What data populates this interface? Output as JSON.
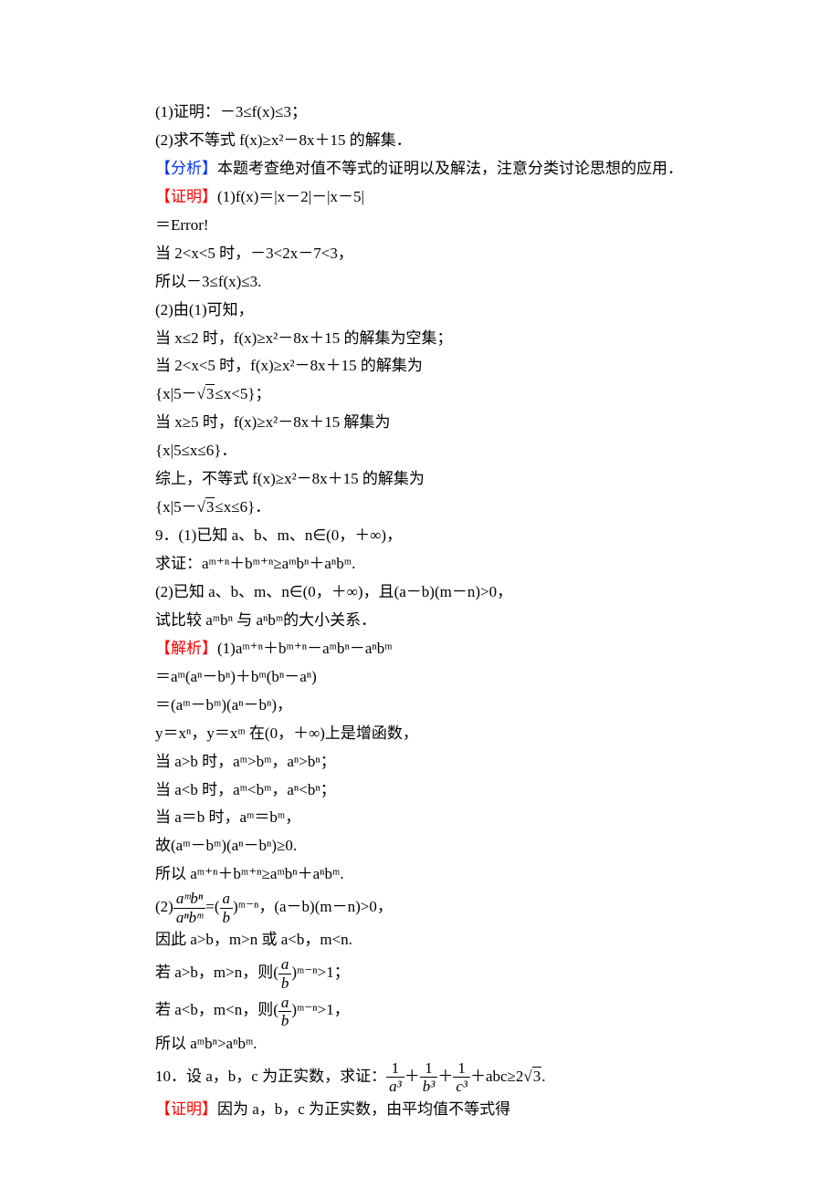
{
  "l1": "(1)证明：－3≤f(x)≤3；",
  "l2": "(2)求不等式 f(x)≥x²－8x＋15 的解集．",
  "l3a": "【分析】",
  "l3b": "本题考查绝对值不等式的证明以及解法，注意分类讨论思想的应用．",
  "l4a": "【证明】",
  "l4b": "(1)f(x)＝|x－2|－|x－5|",
  "l5": "＝Error!",
  "l6": "当 2<x<5 时，－3<2x－7<3，",
  "l7": "所以－3≤f(x)≤3.",
  "l8": "(2)由(1)可知，",
  "l9": "当 x≤2 时，f(x)≥x²－8x＋15 的解集为空集；",
  "l10": "当 2<x<5 时，f(x)≥x²－8x＋15 的解集为",
  "l11a": "{x|5－",
  "l11b": "3",
  "l11c": "≤x<5}；",
  "l12": "当 x≥5 时，f(x)≥x²－8x＋15 解集为",
  "l13": "{x|5≤x≤6}．",
  "l14": "综上，不等式 f(x)≥x²－8x＋15 的解集为",
  "l15a": "{x|5－",
  "l15b": "3",
  "l15c": "≤x≤6}．",
  "l16": "9．(1)已知 a、b、m、n∈(0，＋∞)，",
  "l17": "求证：aᵐ⁺ⁿ＋bᵐ⁺ⁿ≥aᵐbⁿ＋aⁿbᵐ.",
  "l18": "(2)已知 a、b、m、n∈(0，＋∞)，且(a－b)(m－n)>0，",
  "l19": "试比较 aᵐbⁿ 与 aⁿbᵐ的大小关系．",
  "l20a": "【解析】",
  "l20b": "(1)aᵐ⁺ⁿ＋bᵐ⁺ⁿ－aᵐbⁿ－aⁿbᵐ",
  "l21": "＝aᵐ(aⁿ－bⁿ)＋bᵐ(bⁿ－aⁿ)",
  "l22": "＝(aᵐ－bᵐ)(aⁿ－bⁿ)，",
  "l23": "y＝xⁿ，y＝xᵐ 在(0，＋∞)上是增函数，",
  "l24": "当 a>b 时，aᵐ>bᵐ，aⁿ>bⁿ；",
  "l25": "当 a<b 时，aᵐ<bᵐ，aⁿ<bⁿ；",
  "l26": "当 a＝b 时，aᵐ＝bᵐ，",
  "l27": "故(aᵐ－bᵐ)(aⁿ－bⁿ)≥0.",
  "l28": "所以 aᵐ⁺ⁿ＋bᵐ⁺ⁿ≥aᵐbⁿ＋aⁿbᵐ.",
  "l29pre": "(2)",
  "l29f1n": "aᵐbⁿ",
  "l29f1d": "aⁿbᵐ",
  "l29mid": "=(",
  "l29f2n": "a",
  "l29f2d": "b",
  "l29exp": ")ᵐ⁻ⁿ，(a－b)(m－n)>0，",
  "l30": "因此 a>b，m>n 或 a<b，m<n.",
  "l31a": "若 a>b，m>n，则(",
  "l31fn": "a",
  "l31fd": "b",
  "l31b": ")ᵐ⁻ⁿ>1；",
  "l32a": "若 a<b，m<n，则(",
  "l32fn": "a",
  "l32fd": "b",
  "l32b": ")ᵐ⁻ⁿ>1，",
  "l33": "所以 aᵐbⁿ>aⁿbᵐ.",
  "l34a": "10．设 a，b，c 为正实数，求证：",
  "l34f1n": "1",
  "l34f1d": "a³",
  "l34p1": "＋",
  "l34f2n": "1",
  "l34f2d": "b³",
  "l34p2": "＋",
  "l34f3n": "1",
  "l34f3d": "c³",
  "l34b": "＋abc≥2",
  "l34sq": "3",
  "l34end": ".",
  "l35a": "【证明】",
  "l35b": "因为 a，b，c 为正实数，由平均值不等式得"
}
